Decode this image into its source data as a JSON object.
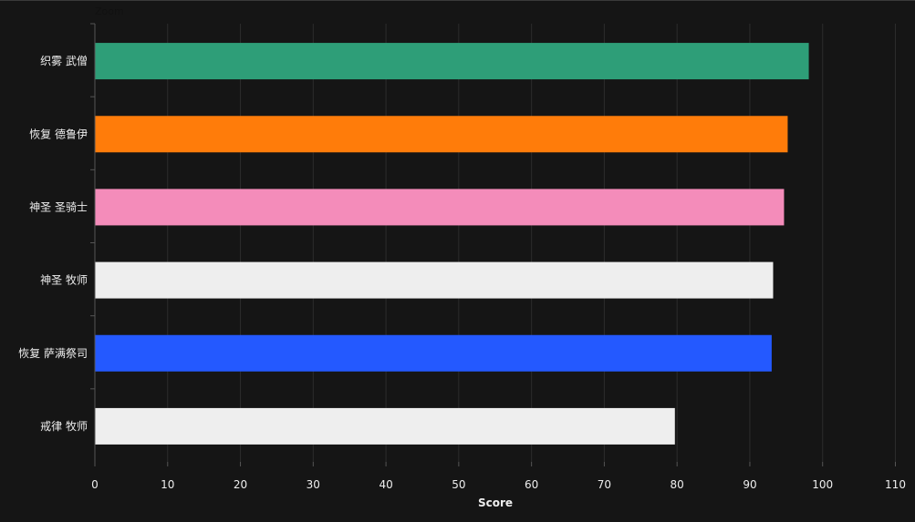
{
  "chart_data": {
    "type": "bar",
    "orientation": "horizontal",
    "title": "Zoom",
    "xlabel": "Score",
    "ylabel": "",
    "xlim": [
      0,
      110
    ],
    "xticks": [
      0,
      10,
      20,
      30,
      40,
      50,
      60,
      70,
      80,
      90,
      100,
      110
    ],
    "grid": true,
    "categories": [
      "织雾 武僧",
      "恢复 德鲁伊",
      "神圣 圣骑士",
      "神圣 牧师",
      "恢复 萨满祭司",
      "戒律 牧师"
    ],
    "values": [
      98.1,
      95.2,
      94.7,
      93.2,
      93.0,
      79.7
    ],
    "colors": [
      "#2e9e78",
      "#ff7c0a",
      "#f48cba",
      "#eeeeee",
      "#2459ff",
      "#eeeeee"
    ]
  }
}
